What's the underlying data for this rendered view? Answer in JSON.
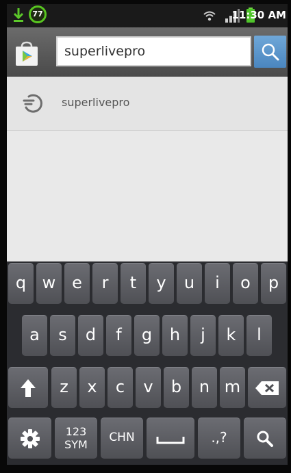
{
  "status_bar": {
    "notification_count": "77",
    "time": "11:30 AM",
    "icons": [
      "download-icon",
      "wifi-icon",
      "signal-icon",
      "battery-icon"
    ]
  },
  "search": {
    "query": "superlivepro",
    "search_icon": "search-icon",
    "store_icon": "play-store-icon"
  },
  "suggestions": [
    {
      "label": "superlivepro",
      "icon": "history-icon"
    }
  ],
  "keyboard": {
    "row1": [
      "q",
      "w",
      "e",
      "r",
      "t",
      "y",
      "u",
      "i",
      "o",
      "p"
    ],
    "row2": [
      "a",
      "s",
      "d",
      "f",
      "g",
      "h",
      "j",
      "k",
      "l"
    ],
    "row3": [
      "z",
      "x",
      "c",
      "v",
      "b",
      "n",
      "m"
    ],
    "symbols_key_line1": "123",
    "symbols_key_line2": "SYM",
    "language_key": "CHN",
    "punctuation_key": ".,?",
    "special_icons": [
      "shift-icon",
      "backspace-icon",
      "settings-icon",
      "space-icon",
      "search-icon"
    ]
  },
  "colors": {
    "status_bar": "#1a1a1a",
    "header": "#5a5a5a",
    "search_button": "#5a94cc",
    "suggestion_bg": "#e6e6e6",
    "keyboard_bg": "#2b2c30",
    "key": "#5c5d62",
    "badge_ring": "#58c520",
    "download_arrow": "#5cc82a"
  }
}
